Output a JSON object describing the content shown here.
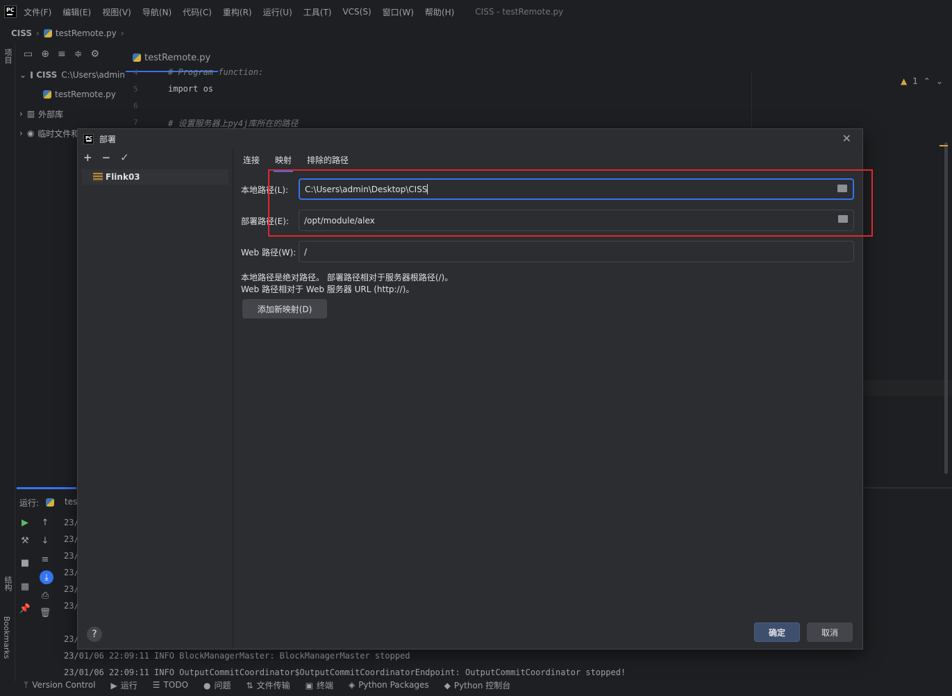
{
  "app": {
    "logo_text": "PC",
    "menu": [
      "文件(F)",
      "编辑(E)",
      "视图(V)",
      "导航(N)",
      "代码(C)",
      "重构(R)",
      "运行(U)",
      "工具(T)",
      "VCS(S)",
      "窗口(W)",
      "帮助(H)"
    ],
    "window_title": "CISS - testRemote.py"
  },
  "breadcrumb": {
    "project": "CISS",
    "file": "testRemote.py"
  },
  "left_strip": {
    "project_label": "项目",
    "structure_label": "结构",
    "bookmarks_label": "Bookmarks"
  },
  "project_tree": [
    {
      "label": "CISS",
      "detail": "C:\\Users\\admin"
    },
    {
      "label": "testRemote.py",
      "detail": ""
    },
    {
      "label": "外部库",
      "detail": ""
    },
    {
      "label": "临时文件和控制台",
      "detail": ""
    }
  ],
  "editor": {
    "tab_label": "testRemote.py",
    "lines": [
      {
        "num": "4",
        "text": "# Program function:"
      },
      {
        "num": "5",
        "text": "import os"
      },
      {
        "num": "6",
        "text": ""
      },
      {
        "num": "7",
        "text": "# 设置服务器上py4j库所在的路径"
      }
    ],
    "warning_count": "1"
  },
  "run_panel": {
    "label": "运行:",
    "tab": "tes",
    "log": [
      "23/",
      "23/",
      "23/",
      "23/",
      "23/",
      "23/",
      "23/",
      "23/01/06 22:09:11 INFO BlockManagerMaster: BlockManagerMaster stopped",
      "23/01/06 22:09:11 INFO OutputCommitCoordinator$OutputCommitCoordinatorEndpoint: OutputCommitCoordinator stopped!"
    ]
  },
  "statusbar": [
    {
      "icon": "branch-icon",
      "label": "Version Control"
    },
    {
      "icon": "run-icon",
      "label": "运行"
    },
    {
      "icon": "todo-icon",
      "label": "TODO"
    },
    {
      "icon": "problems-icon",
      "label": "问题"
    },
    {
      "icon": "file-transfer-icon",
      "label": "文件传输"
    },
    {
      "icon": "terminal-icon",
      "label": "终端"
    },
    {
      "icon": "packages-icon",
      "label": "Python Packages"
    },
    {
      "icon": "python-console-icon",
      "label": "Python 控制台"
    }
  ],
  "dialog": {
    "title": "部署",
    "server_name": "Flink03",
    "tabs": [
      "连接",
      "映射",
      "排除的路径"
    ],
    "active_tab": 1,
    "local_path_label": "本地路径(L):",
    "local_path_value": "C:\\Users\\admin\\Desktop\\CISS",
    "deploy_path_label": "部署路径(E):",
    "deploy_path_value": "/opt/module/alex",
    "web_path_label": "Web 路径(W):",
    "web_path_value": "/",
    "hint_line1": "本地路径是绝对路径。 部署路径相对于服务器根路径(/)。",
    "hint_line2": "Web 路径相对于 Web 服务器 URL (http://)。",
    "add_mapping_button": "添加新映射(D)",
    "ok_button": "确定",
    "cancel_button": "取消",
    "help": "?"
  },
  "colors": {
    "accent": "#3574f0",
    "highlight_box": "#e3262f",
    "warning": "#d9a343"
  }
}
